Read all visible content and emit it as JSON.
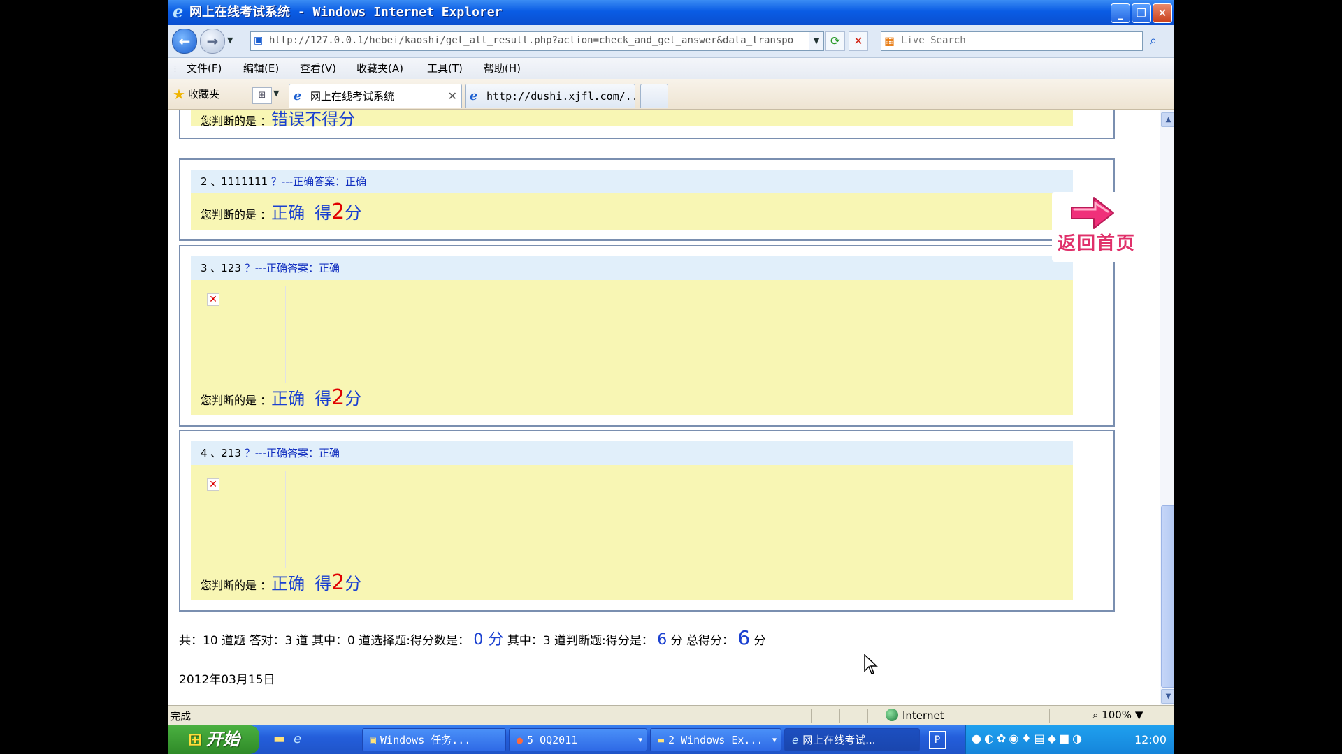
{
  "window": {
    "title": "网上在线考试系统 - Windows Internet Explorer",
    "controls": {
      "minimize": "_",
      "maximize": "❐",
      "close": "✕"
    }
  },
  "addressbar": {
    "url": "http://127.0.0.1/hebei/kaoshi/get_all_result.php?action=check_and_get_answer&data_transpo",
    "search_placeholder": "Live Search",
    "refresh": "⟳",
    "stop": "✕"
  },
  "menubar": [
    "文件(F)",
    "编辑(E)",
    "查看(V)",
    "收藏夹(A)",
    "工具(T)",
    "帮助(H)"
  ],
  "favorites": {
    "label": "收藏夹"
  },
  "tabs": [
    {
      "label": "网上在线考试系统",
      "active": true,
      "close": "✕"
    },
    {
      "label": "http://dushi.xjfl.com/...",
      "active": false
    }
  ],
  "judge_label": "您判断的是 ：",
  "questions": [
    {
      "judge_result": "错误不得分"
    },
    {
      "number": "2 、1111111",
      "answer_text": "？---正确答案：正确",
      "judge_result": "正确",
      "score_prefix": "得",
      "score": "2",
      "score_suffix": "分"
    },
    {
      "number": "3 、123",
      "answer_text": "？---正确答案：正确",
      "judge_result": "正确",
      "score_prefix": "得",
      "score": "2",
      "score_suffix": "分"
    },
    {
      "number": "4 、213",
      "answer_text": "？---正确答案：正确",
      "judge_result": "正确",
      "score_prefix": "得",
      "score": "2",
      "score_suffix": "分"
    }
  ],
  "home_link": {
    "label": "返回首页",
    "icon": "arrow-right-icon"
  },
  "summary": {
    "part1": "共：10 道题 答对：3 道 其中：0 道选择题:得分数是：",
    "choice_score": "0 分",
    "part2": "其中：3 道判断题:得分是：",
    "judge_score": "6",
    "part3": "分 总得分：",
    "total_score": "6",
    "part4": "分"
  },
  "date": "2012年03月15日",
  "statusbar": {
    "status": "完成",
    "zone": "Internet",
    "zoom": "100%"
  },
  "taskbar": {
    "start": "开始",
    "tasks": [
      "Windows 任务...",
      "5 QQ2011",
      "2 Windows Ex...",
      "网上在线考试..."
    ],
    "clock": "12:00",
    "ime": "P"
  },
  "colors": {
    "accent_blue": "#1a40d0",
    "score_red": "#e00000",
    "answer_bg": "#f8f6b4",
    "question_bg": "#e1effa",
    "home_pink": "#e0306a"
  }
}
